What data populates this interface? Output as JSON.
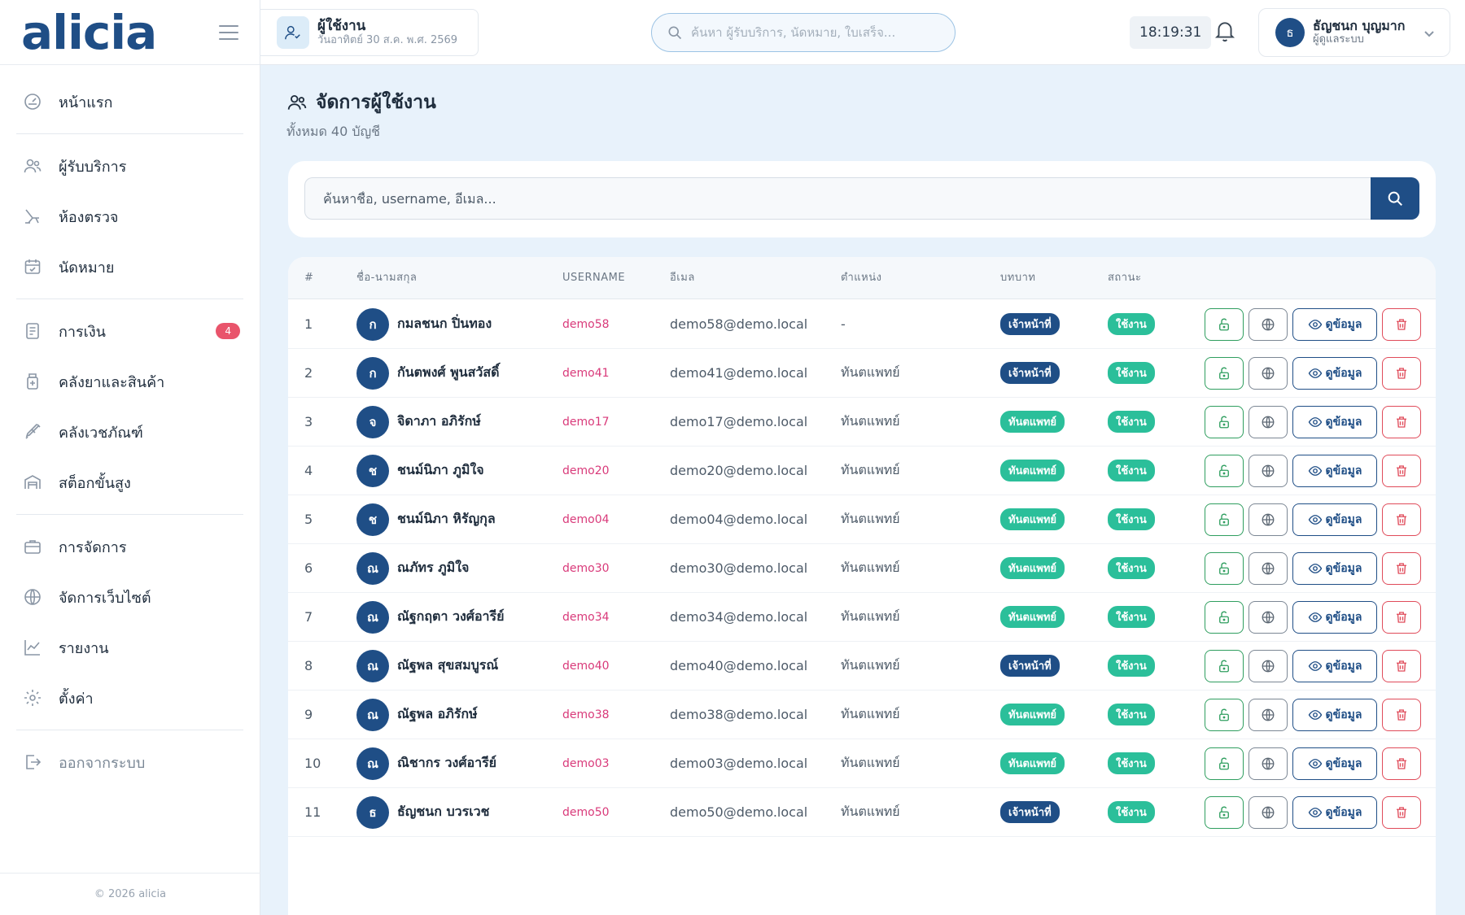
{
  "brand": {
    "logo": "alicia"
  },
  "sidebar": {
    "items": [
      {
        "label": "หน้าแรก",
        "icon": "dashboard-icon"
      },
      {
        "label": "ผู้รับบริการ",
        "icon": "users-icon"
      },
      {
        "label": "ห้องตรวจ",
        "icon": "dental-chair-icon"
      },
      {
        "label": "นัดหมาย",
        "icon": "calendar-check-icon"
      },
      {
        "label": "การเงิน",
        "icon": "receipt-icon",
        "badge": "4"
      },
      {
        "label": "คลังยาและสินค้า",
        "icon": "medicine-bottle-icon"
      },
      {
        "label": "คลังเวชภัณฑ์",
        "icon": "syringe-icon"
      },
      {
        "label": "สต็อกขั้นสูง",
        "icon": "warehouse-icon"
      },
      {
        "label": "การจัดการ",
        "icon": "briefcase-icon"
      },
      {
        "label": "จัดการเว็บไซต์",
        "icon": "globe-icon"
      },
      {
        "label": "รายงาน",
        "icon": "chart-line-icon"
      },
      {
        "label": "ตั้งค่า",
        "icon": "gear-icon"
      },
      {
        "label": "ออกจากระบบ",
        "icon": "logout-icon"
      }
    ],
    "copyright": "© 2026 alicia"
  },
  "topbar": {
    "page_title": "ผู้ใช้งาน",
    "page_date": "วันอาทิตย์ 30 ส.ค. พ.ศ. 2569",
    "search_placeholder": "ค้นหา ผู้รับบริการ, นัดหมาย, ใบเสร็จ...",
    "clock": "18:19:31",
    "user_initial": "ธ",
    "user_name": "ธัญชนก บุญมาก",
    "user_role": "ผู้ดูแลระบบ"
  },
  "main": {
    "title": "จัดการผู้ใช้งาน",
    "subtitle": "ทั้งหมด 40 บัญชี",
    "search_placeholder": "ค้นหาชื่อ, username, อีเมล..."
  },
  "table": {
    "headers": {
      "num": "#",
      "name": "ชื่อ-นามสกุล",
      "username": "USERNAME",
      "email": "อีเมล",
      "position": "ตำแหน่ง",
      "role": "บทบาท",
      "status": "สถานะ"
    },
    "view_label": "ดูข้อมูล",
    "rows": [
      {
        "num": "1",
        "initial": "ก",
        "name": "กมลชนก ปิ่นทอง",
        "username": "demo58",
        "email": "demo58@demo.local",
        "position": "-",
        "role": "เจ้าหน้าที่",
        "role_type": "staff",
        "status": "ใช้งาน"
      },
      {
        "num": "2",
        "initial": "ก",
        "name": "กันตพงศ์ พูนสวัสดิ์",
        "username": "demo41",
        "email": "demo41@demo.local",
        "position": "ทันตแพทย์",
        "role": "เจ้าหน้าที่",
        "role_type": "staff",
        "status": "ใช้งาน"
      },
      {
        "num": "3",
        "initial": "จ",
        "name": "จิดาภา อภิรักษ์",
        "username": "demo17",
        "email": "demo17@demo.local",
        "position": "ทันตแพทย์",
        "role": "ทันตแพทย์",
        "role_type": "dentist",
        "status": "ใช้งาน"
      },
      {
        "num": "4",
        "initial": "ช",
        "name": "ชนม์นิภา ภูมิใจ",
        "username": "demo20",
        "email": "demo20@demo.local",
        "position": "ทันตแพทย์",
        "role": "ทันตแพทย์",
        "role_type": "dentist",
        "status": "ใช้งาน"
      },
      {
        "num": "5",
        "initial": "ช",
        "name": "ชนม์นิภา หิรัญกุล",
        "username": "demo04",
        "email": "demo04@demo.local",
        "position": "ทันตแพทย์",
        "role": "ทันตแพทย์",
        "role_type": "dentist",
        "status": "ใช้งาน"
      },
      {
        "num": "6",
        "initial": "ณ",
        "name": "ณภัทร ภูมิใจ",
        "username": "demo30",
        "email": "demo30@demo.local",
        "position": "ทันตแพทย์",
        "role": "ทันตแพทย์",
        "role_type": "dentist",
        "status": "ใช้งาน"
      },
      {
        "num": "7",
        "initial": "ณ",
        "name": "ณัฐกฤตา วงศ์อารีย์",
        "username": "demo34",
        "email": "demo34@demo.local",
        "position": "ทันตแพทย์",
        "role": "ทันตแพทย์",
        "role_type": "dentist",
        "status": "ใช้งาน"
      },
      {
        "num": "8",
        "initial": "ณ",
        "name": "ณัฐพล สุขสมบูรณ์",
        "username": "demo40",
        "email": "demo40@demo.local",
        "position": "ทันตแพทย์",
        "role": "เจ้าหน้าที่",
        "role_type": "staff",
        "status": "ใช้งาน"
      },
      {
        "num": "9",
        "initial": "ณ",
        "name": "ณัฐพล อภิรักษ์",
        "username": "demo38",
        "email": "demo38@demo.local",
        "position": "ทันตแพทย์",
        "role": "ทันตแพทย์",
        "role_type": "dentist",
        "status": "ใช้งาน"
      },
      {
        "num": "10",
        "initial": "ณ",
        "name": "ณิชากร วงศ์อารีย์",
        "username": "demo03",
        "email": "demo03@demo.local",
        "position": "ทันตแพทย์",
        "role": "ทันตแพทย์",
        "role_type": "dentist",
        "status": "ใช้งาน"
      },
      {
        "num": "11",
        "initial": "ธ",
        "name": "ธัญชนก บวรเวช",
        "username": "demo50",
        "email": "demo50@demo.local",
        "position": "ทันตแพทย์",
        "role": "เจ้าหน้าที่",
        "role_type": "staff",
        "status": "ใช้งาน"
      }
    ]
  },
  "colors": {
    "primary": "#1f4e86",
    "accent_green": "#2bbf9a",
    "danger": "#e04b5a",
    "username_pink": "#d93a7a",
    "page_bg": "#e8f2fb"
  }
}
